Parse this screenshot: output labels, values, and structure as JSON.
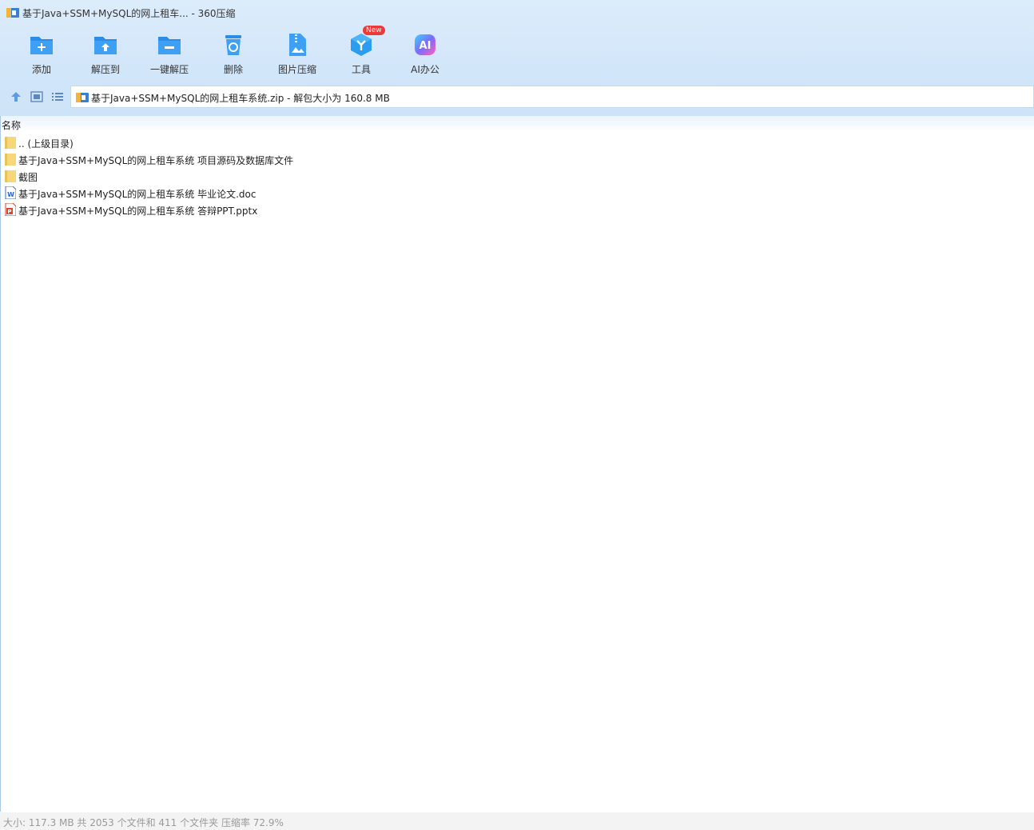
{
  "window": {
    "title": "基于Java+SSM+MySQL的网上租车... - 360压缩"
  },
  "toolbar": {
    "items": [
      {
        "label": "添加",
        "icon": "add-folder-icon"
      },
      {
        "label": "解压到",
        "icon": "extract-to-icon"
      },
      {
        "label": "一键解压",
        "icon": "one-click-extract-icon"
      },
      {
        "label": "删除",
        "icon": "delete-icon"
      },
      {
        "label": "图片压缩",
        "icon": "image-compress-icon"
      },
      {
        "label": "工具",
        "icon": "tools-icon",
        "badge": "New"
      },
      {
        "label": "AI办公",
        "icon": "ai-office-icon"
      }
    ]
  },
  "navbar": {
    "address": "基于Java+SSM+MySQL的网上租车系统.zip - 解包大小为 160.8 MB"
  },
  "list": {
    "column_name": "名称",
    "rows": [
      {
        "name": ".. (上级目录)",
        "icon": "folder-icon"
      },
      {
        "name": "基于Java+SSM+MySQL的网上租车系统 项目源码及数据库文件",
        "icon": "folder-icon"
      },
      {
        "name": "截图",
        "icon": "folder-icon"
      },
      {
        "name": "基于Java+SSM+MySQL的网上租车系统 毕业论文.doc",
        "icon": "word-doc-icon"
      },
      {
        "name": "基于Java+SSM+MySQL的网上租车系统 答辩PPT.pptx",
        "icon": "ppt-file-icon"
      }
    ]
  },
  "status": {
    "text": "大小: 117.3 MB 共 2053 个文件和 411 个文件夹 压缩率 72.9%"
  },
  "colors": {
    "accent": "#2f8ff0",
    "badge": "#ea3b3b",
    "folder": "#f7d77a"
  }
}
